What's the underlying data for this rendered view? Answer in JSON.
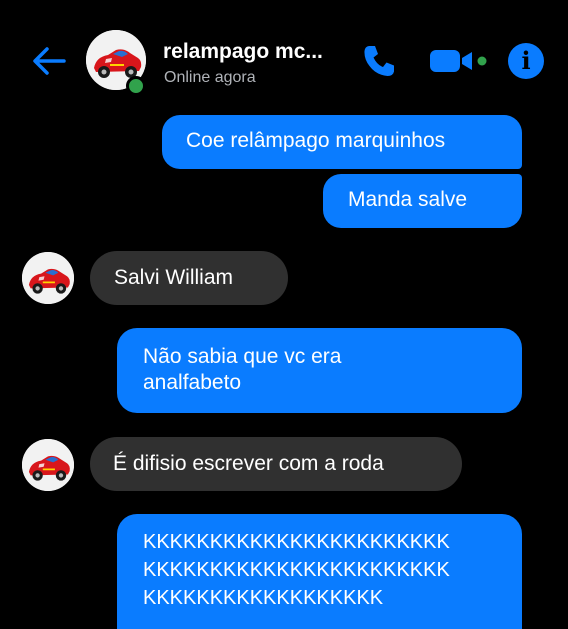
{
  "header": {
    "contact_name": "relampago mc...",
    "status": "Online agora",
    "icons": {
      "back": "back-arrow-icon",
      "phone": "phone-icon",
      "video": "video-camera-icon",
      "info": "info-icon",
      "info_glyph": "i"
    }
  },
  "messages": [
    {
      "direction": "out",
      "text": "Coe relâmpago marquinhos"
    },
    {
      "direction": "out",
      "text": "Manda salve"
    },
    {
      "direction": "in",
      "text": "Salvi William"
    },
    {
      "direction": "out",
      "lines": [
        "Não sabia que vc era",
        "analfabeto"
      ]
    },
    {
      "direction": "in",
      "text": "É difisio escrever com a roda"
    },
    {
      "direction": "out",
      "lines": [
        "KKKKKKKKKKKKKKKKKKKKKKK",
        "KKKKKKKKKKKKKKKKKKKKKKK",
        "KKKKKKKKKKKKKKKKKK"
      ]
    }
  ],
  "colors": {
    "background": "#000000",
    "outgoing_bubble": "#0a7cff",
    "incoming_bubble": "#303030",
    "accent": "#0a7cff",
    "online": "#31a24c",
    "secondary_text": "#b0b3b8"
  }
}
